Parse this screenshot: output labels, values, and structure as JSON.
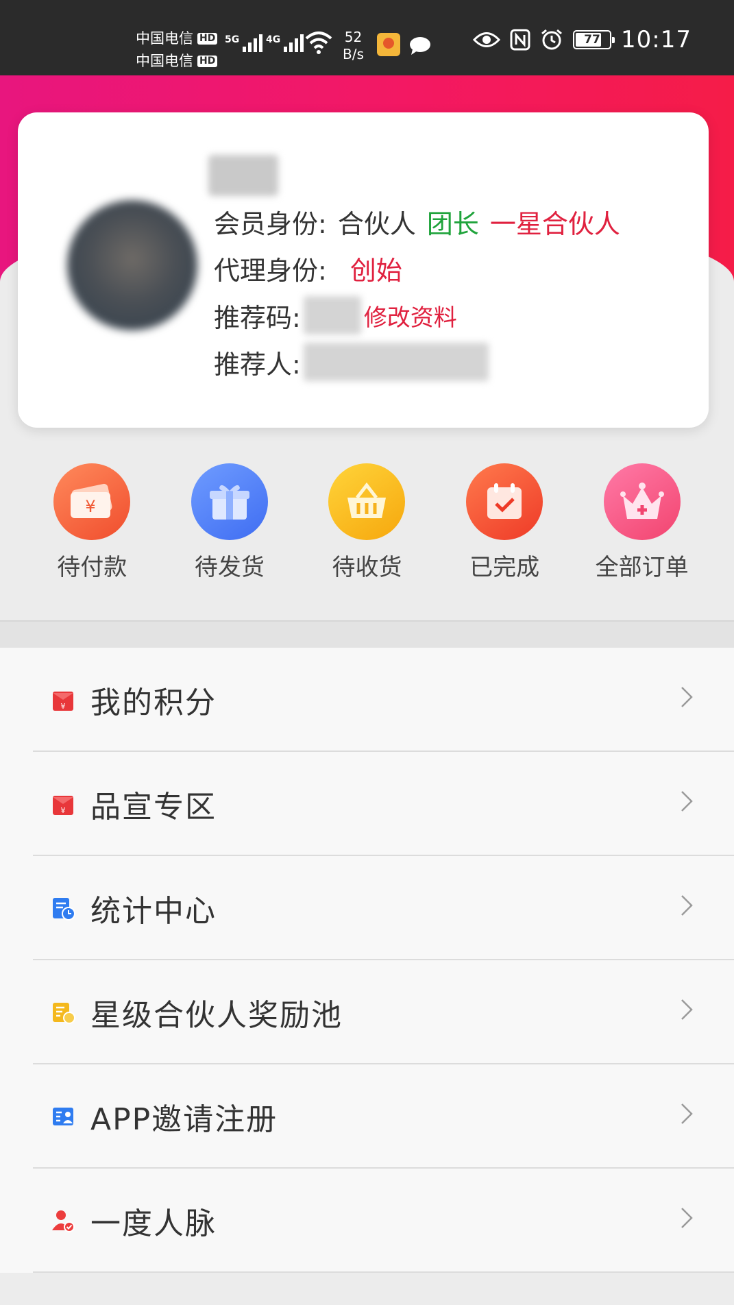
{
  "status_bar": {
    "carrier_1": "中国电信",
    "carrier_2": "中国电信",
    "hd_badge": "HD",
    "sim1_network": "5G",
    "sim2_network": "4G",
    "net_speed_value": "52",
    "net_speed_unit": "B/s",
    "battery_level": "77",
    "battery_fraction": 0.77,
    "time": "10:17"
  },
  "profile": {
    "member_label": "会员身份:",
    "member_role": "合伙人",
    "member_tag_green": "团长",
    "member_tag_red": "一星合伙人",
    "agent_label": "代理身份:",
    "agent_role": "创始",
    "referral_code_label": "推荐码:",
    "edit_profile": "修改资料",
    "referrer_label": "推荐人:"
  },
  "orders": [
    {
      "label": "待付款",
      "icon": "wallet-icon"
    },
    {
      "label": "待发货",
      "icon": "gift-box-icon"
    },
    {
      "label": "待收货",
      "icon": "basket-icon"
    },
    {
      "label": "已完成",
      "icon": "calendar-check-icon"
    },
    {
      "label": "全部订单",
      "icon": "crown-icon"
    }
  ],
  "menu": [
    {
      "label": "我的积分",
      "icon": "red-envelope-icon",
      "color": "#e8373a"
    },
    {
      "label": "品宣专区",
      "icon": "red-envelope-icon",
      "color": "#e8373a"
    },
    {
      "label": "统计中心",
      "icon": "stats-document-icon",
      "color": "#2f7cf0"
    },
    {
      "label": "星级合伙人奖励池",
      "icon": "reward-list-icon",
      "color": "#f4b81d"
    },
    {
      "label": "APP邀请注册",
      "icon": "invite-card-icon",
      "color": "#2f7cf0"
    },
    {
      "label": "一度人脉",
      "icon": "contact-person-icon",
      "color": "#ec3d3d"
    }
  ],
  "colors": {
    "brand_pink": "#f31863",
    "tag_green": "#1fa33b",
    "tag_red": "#e0213f"
  }
}
